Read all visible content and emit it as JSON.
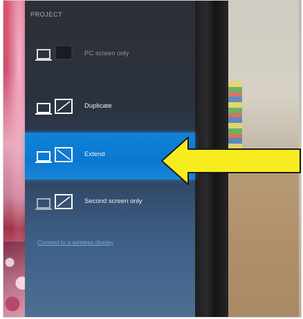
{
  "panel": {
    "title": "PROJECT",
    "options": [
      {
        "label": "PC screen only",
        "icon": "pc-screen-only-icon",
        "selected": false
      },
      {
        "label": "Duplicate",
        "icon": "duplicate-icon",
        "selected": false
      },
      {
        "label": "Extend",
        "icon": "extend-icon",
        "selected": true
      },
      {
        "label": "Second screen only",
        "icon": "second-screen-only-icon",
        "selected": false
      }
    ],
    "wireless_link": "Connect to a wireless display"
  },
  "annotation": {
    "icon": "arrow-left-icon",
    "color": "#f7ec1f"
  },
  "colors": {
    "selected": "#0a78d0",
    "panel": "#2c3340"
  }
}
